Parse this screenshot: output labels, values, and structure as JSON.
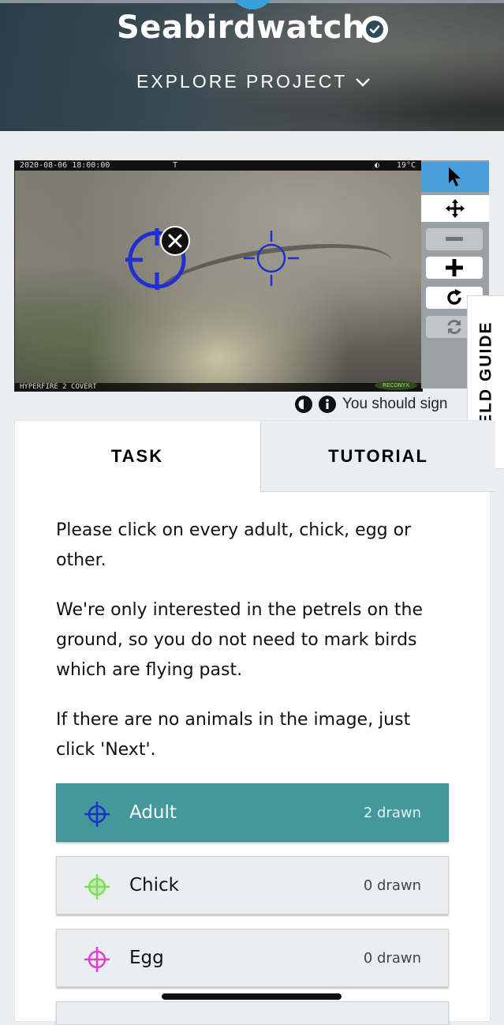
{
  "header": {
    "title": "Seabirdwatch",
    "explore_label": "EXPLORE PROJECT"
  },
  "camera": {
    "timestamp": "2020-08-06 18:00:00",
    "flag": "T",
    "temperature": "19°C",
    "model": "HYPERFIRE 2 COVERT",
    "brand": "RECONYX"
  },
  "toolbar": {
    "tools": [
      "pointer-icon",
      "move-icon",
      "zoom-out-icon",
      "zoom-in-icon",
      "rotate-icon",
      "reset-icon"
    ]
  },
  "field_guide_label": "FIELD GUIDE",
  "meta": {
    "signin_text": "You should sign"
  },
  "tabs": {
    "task": "TASK",
    "tutorial": "TUTORIAL"
  },
  "instructions": {
    "p1": "Please click on every adult, chick, egg or other.",
    "p2": "We're only interested in the petrels on the ground, so you do not need to mark birds which are flying past.",
    "p3": "If there are no animals in the image, just click 'Next'."
  },
  "answers": [
    {
      "label": "Adult",
      "count": "2 drawn",
      "color": "#1f2fd0",
      "selected": true
    },
    {
      "label": "Chick",
      "count": "0 drawn",
      "color": "#7ee05a",
      "selected": false
    },
    {
      "label": "Egg",
      "count": "0 drawn",
      "color": "#e040d0",
      "selected": false
    }
  ],
  "colors": {
    "accent_teal": "#43989b",
    "toolbar_active": "#4a9fdb"
  }
}
